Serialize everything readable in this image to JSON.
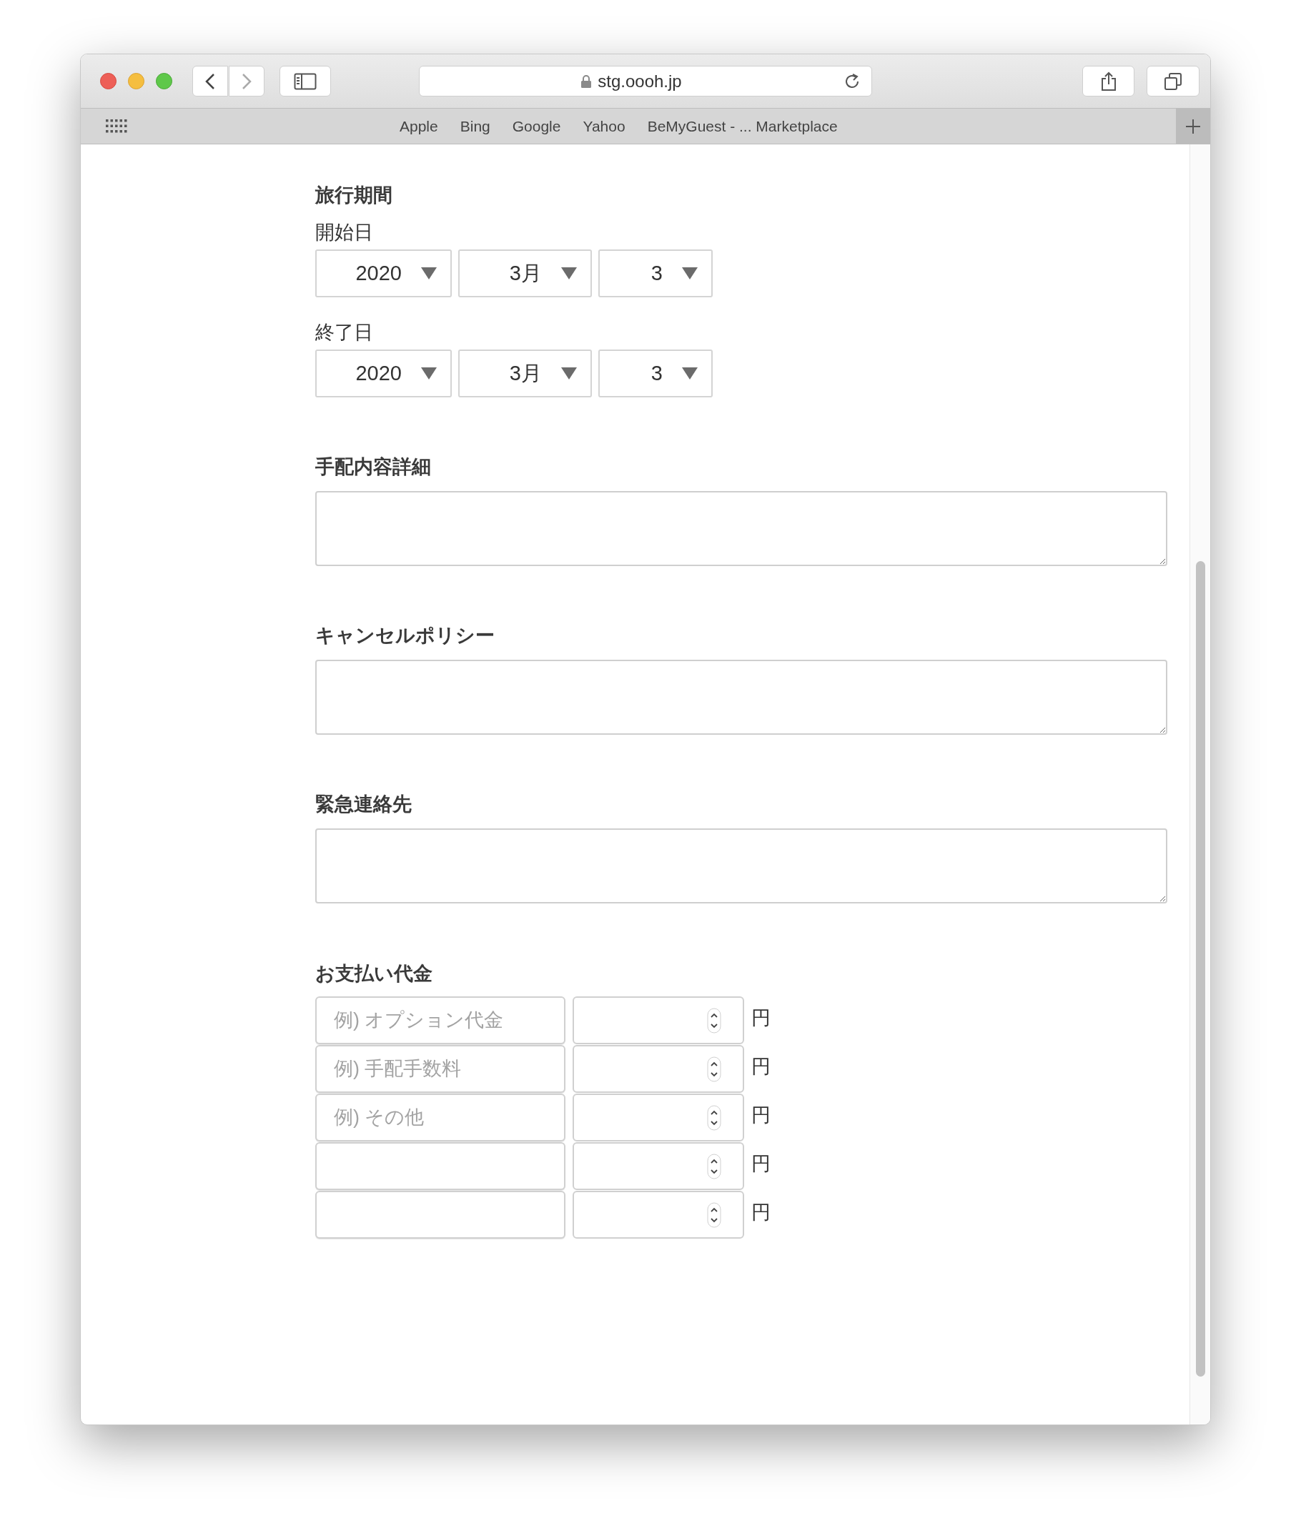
{
  "window": {
    "url": "stg.oooh.jp"
  },
  "bookmarks": [
    "Apple",
    "Bing",
    "Google",
    "Yahoo",
    "BeMyGuest - ... Marketplace"
  ],
  "travel_period": {
    "heading": "旅行期間",
    "dates": [
      {
        "label": "開始日",
        "year": "2020",
        "month": "3月",
        "day": "3"
      },
      {
        "label": "終了日",
        "year": "2020",
        "month": "3月",
        "day": "3"
      }
    ]
  },
  "text_sections": [
    {
      "heading": "手配内容詳細"
    },
    {
      "heading": "キャンセルポリシー"
    },
    {
      "heading": "緊急連絡先"
    }
  ],
  "payment": {
    "heading": "お支払い代金",
    "rows": [
      {
        "placeholder": "例) オプション代金",
        "unit": "円"
      },
      {
        "placeholder": "例) 手配手数料",
        "unit": "円"
      },
      {
        "placeholder": "例) その他",
        "unit": "円"
      },
      {
        "unit": "円"
      },
      {
        "unit": "円"
      }
    ]
  }
}
